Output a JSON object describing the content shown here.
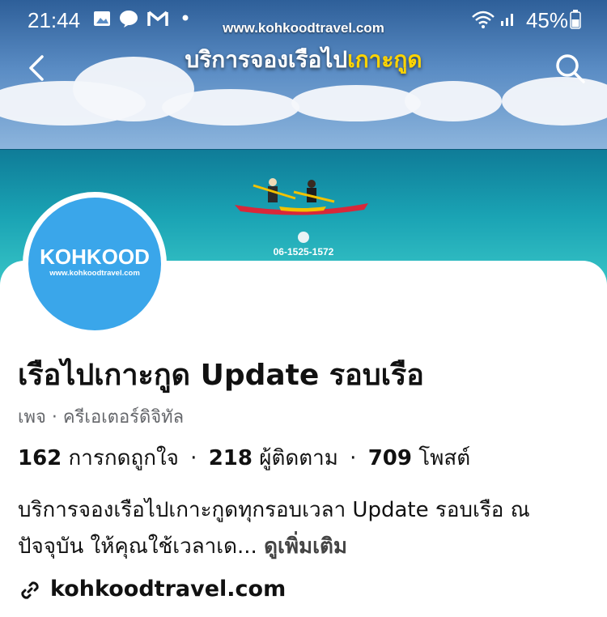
{
  "status_bar": {
    "time": "21:44",
    "battery": "45%",
    "icons": [
      "gallery-icon",
      "line-chat-icon",
      "gmail-icon",
      "dot-icon",
      "wifi-icon",
      "signal-icon",
      "battery-icon"
    ]
  },
  "cover": {
    "website": "www.kohkoodtravel.com",
    "title_part1": "บริการจองเรือไป",
    "title_part2": "เกาะกูด",
    "phone": "06-1525-1572",
    "highlight_color": "#ffd400"
  },
  "header": {
    "back_icon": "back-arrow-icon",
    "search_icon": "search-icon"
  },
  "avatar": {
    "brand": "KOHKOOD",
    "url": "www.kohkoodtravel.com",
    "color": "#3aa6ea"
  },
  "profile": {
    "name": "เรือไปเกาะกูด Update รอบเรือ",
    "category": "เพจ · ครีเอเตอร์ดิจิทัล",
    "likes_count": "162",
    "likes_label": "การกดถูกใจ",
    "followers_count": "218",
    "followers_label": "ผู้ติดตาม",
    "posts_count": "709",
    "posts_label": "โพสต์",
    "separator": "·",
    "bio": "บริการจองเรือไปเกาะกูดทุกรอบเวลา Update รอบเรือ ณ ปัจจุบัน ให้คุณใช้เวลาเด...",
    "see_more": "ดูเพิ่มเติม",
    "website": "kohkoodtravel.com"
  }
}
